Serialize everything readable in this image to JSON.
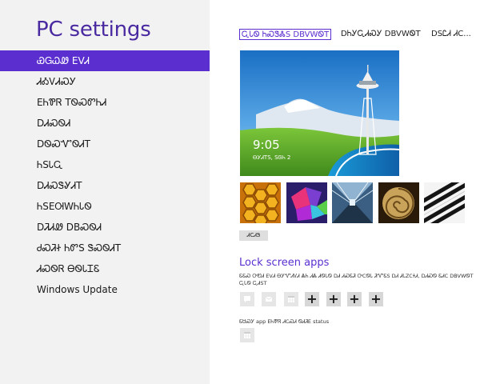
{
  "left_pane": {
    "title": "PC settings",
    "categories": [
      {
        "label": "ᏯᏀᏇᏪ EVᏗ",
        "selected": true
      },
      {
        "label": "ᏗᎣᏙᏗᏍᎩ",
        "selected": false
      },
      {
        "label": "EᏂᏈᏒ TᏫᏍᏛᏂᏗ",
        "selected": false
      },
      {
        "label": "DᏗᏍᏫᏗ",
        "selected": false
      },
      {
        "label": "DᏫᏍᏉᏫᏗT",
        "selected": false
      },
      {
        "label": "ᏂSᏓᏩ",
        "selected": false
      },
      {
        "label": "DᏗᏍᏕᎽᏗT",
        "selected": false
      },
      {
        "label": "ᏂSEᎺWᏂᏓᏫ",
        "selected": false
      },
      {
        "label": "DᏘᏗᏪ DBᏍᏫᏗ",
        "selected": false
      },
      {
        "label": "ᏧᏍᏘᏐ ᏂᏛS ᏕᏍᏫᏗT",
        "selected": false
      },
      {
        "label": "ᏗᏍᏫᏒ ᎾᏫᏓᏆᏋ",
        "selected": false
      },
      {
        "label": "Windows Update",
        "selected": false
      }
    ]
  },
  "tabs": [
    {
      "label": "ᏩᏓᏫ ᏂᏍᏕᏜS DBVWᏫT",
      "active": true
    },
    {
      "label": "DᏂᎩᏩᏗᏍᎩ DBVWᏫT",
      "active": false
    },
    {
      "label": "DSᏝᏗ ᏗC...",
      "active": false
    }
  ],
  "lock_preview": {
    "time": "9:05",
    "date": "ᎾᎩᏗTS, SᎶᏂ 2"
  },
  "thumbnails": [
    {
      "name": "honeycomb"
    },
    {
      "name": "colored-tiles"
    },
    {
      "name": "station"
    },
    {
      "name": "nautilus-shell"
    },
    {
      "name": "piano-keys"
    }
  ],
  "browse_button": "ᏗCᏗᏕ",
  "lock_screen_apps": {
    "heading": "Lock screen apps",
    "description": "ᏋᏋᏍ ᎤᏬᏗ EVᏗ ᎾᎩᏉᏗᏙᏗ ᏜᏂ ᏗᏜ ᏗᏫᏓᏫ DᏗ ᏗᏍᏋᏘ ᎤCᏫᏓ ᏘᏉᏋS DᏗ ᏗᏓZCᏐᏗ, DᏗᏍᏫ ᏋᏗC DBVWᏫT ᏩᏓᏫ ᏩᏗST",
    "slots": [
      {
        "kind": "filled",
        "icon": "message-icon"
      },
      {
        "kind": "filled",
        "icon": "mail-icon"
      },
      {
        "kind": "filled",
        "icon": "calendar-icon"
      },
      {
        "kind": "empty",
        "symbol": "+"
      },
      {
        "kind": "empty",
        "symbol": "+"
      },
      {
        "kind": "empty",
        "symbol": "+"
      },
      {
        "kind": "empty",
        "symbol": "+"
      }
    ],
    "detailed_label": "ᏋᏌᏍᎩ app EᏂᏈᏒ ᏗCᏍᏗ ᏫᏗᏘE status",
    "detailed_slot_icon": "calendar-icon"
  },
  "colors": {
    "accent": "#5b2fcf",
    "title": "#4a2aa0",
    "left_pane_bg": "#f2f2f2"
  }
}
